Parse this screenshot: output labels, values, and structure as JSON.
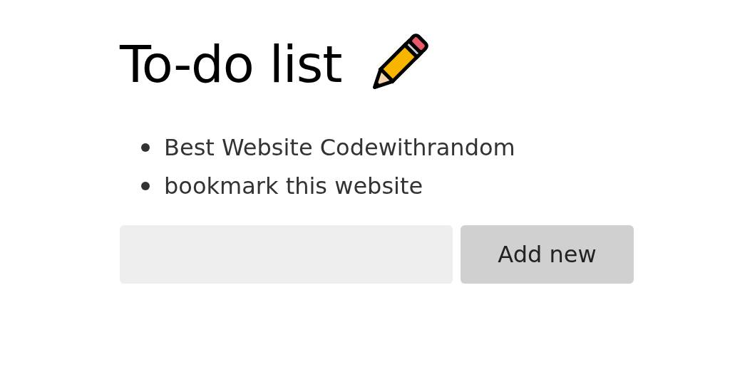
{
  "title": "To-do list",
  "items": [
    {
      "text": "Best Website Codewithrandom"
    },
    {
      "text": "bookmark this website"
    }
  ],
  "add_button": {
    "label": "Add new"
  }
}
